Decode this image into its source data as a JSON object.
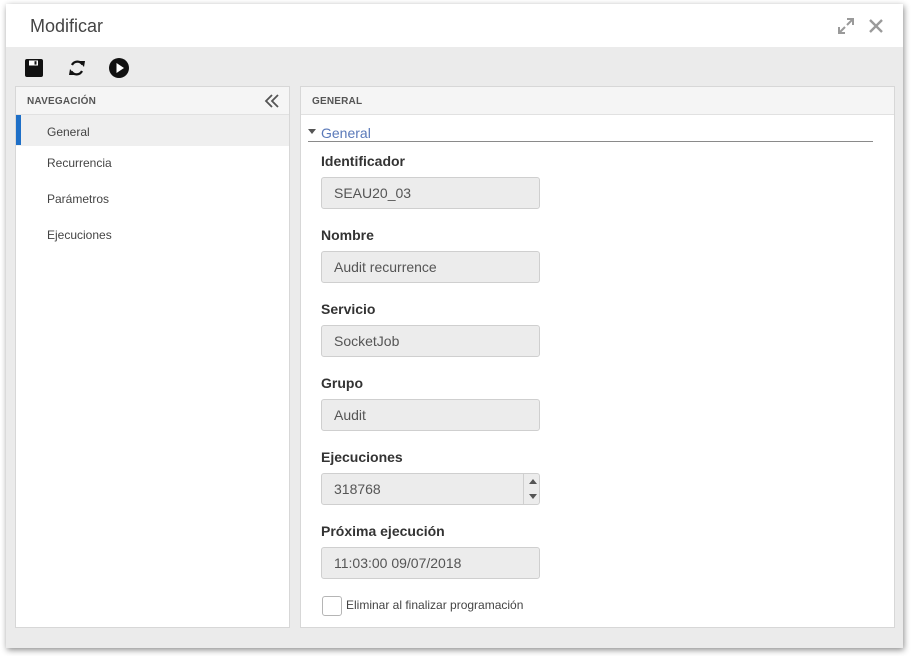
{
  "window": {
    "title": "Modificar"
  },
  "toolbar": {
    "icons": [
      "save-icon",
      "refresh-icon",
      "play-icon"
    ]
  },
  "nav": {
    "header": "NAVEGACIÓN",
    "items": [
      {
        "label": "General",
        "active": true
      },
      {
        "label": "Recurrencia"
      },
      {
        "label": "Parámetros"
      },
      {
        "label": "Ejecuciones"
      }
    ]
  },
  "main": {
    "header": "GENERAL",
    "section_title": "General",
    "fields": {
      "identificador": {
        "label": "Identificador",
        "value": "SEAU20_03"
      },
      "nombre": {
        "label": "Nombre",
        "value": "Audit recurrence"
      },
      "servicio": {
        "label": "Servicio",
        "value": "SocketJob"
      },
      "grupo": {
        "label": "Grupo",
        "value": "Audit"
      },
      "ejecuciones": {
        "label": "Ejecuciones",
        "value": "318768"
      },
      "proxima": {
        "label": "Próxima ejecución",
        "value": "11:03:00 09/07/2018"
      }
    },
    "checkbox": {
      "label": "Eliminar al finalizar programación",
      "checked": false
    }
  },
  "colors": {
    "accent": "#1e6fc7",
    "section_link": "#5a79b9"
  }
}
